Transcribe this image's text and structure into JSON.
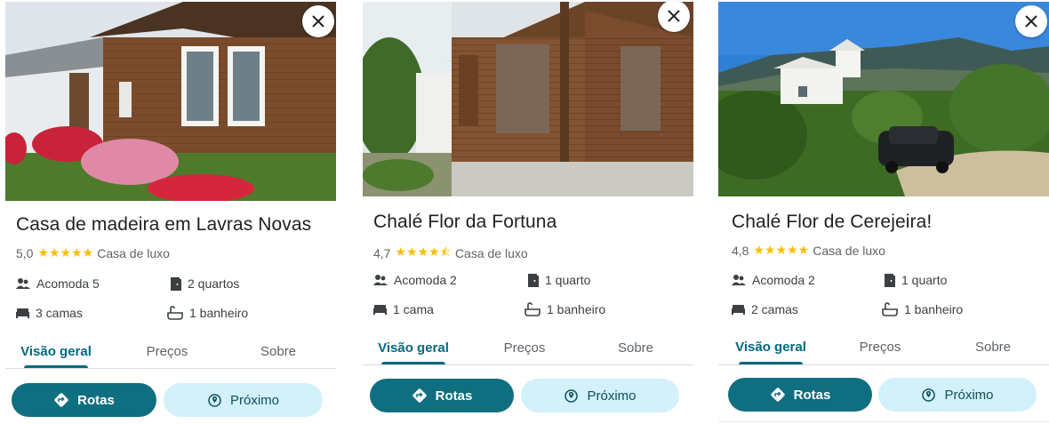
{
  "cards": [
    {
      "title": "Casa de madeira em Lavras Novas",
      "rating": "5,0",
      "stars": "★★★★★",
      "category": "Casa de luxo",
      "guests": "Acomoda 5",
      "bedrooms": "2 quartos",
      "beds": "3 camas",
      "bathrooms": "1 banheiro",
      "tabs": [
        "Visão geral",
        "Preços",
        "Sobre"
      ],
      "directions_label": "Rotas",
      "nearby_label": "Próximo",
      "close_icon": "close-icon"
    },
    {
      "title": "Chalé Flor da Fortuna",
      "rating": "4,7",
      "stars": "★★★★⯪",
      "category": "Casa de luxo",
      "guests": "Acomoda 2",
      "bedrooms": "1 quarto",
      "beds": "1 cama",
      "bathrooms": "1 banheiro",
      "tabs": [
        "Visão geral",
        "Preços",
        "Sobre"
      ],
      "directions_label": "Rotas",
      "nearby_label": "Próximo",
      "close_icon": "close-icon"
    },
    {
      "title": "Chalé Flor de Cerejeira!",
      "rating": "4,8",
      "stars": "★★★★★",
      "category": "Casa de luxo",
      "guests": "Acomoda 2",
      "bedrooms": "1 quarto",
      "beds": "2 camas",
      "bathrooms": "1 banheiro",
      "tabs": [
        "Visão geral",
        "Preços",
        "Sobre"
      ],
      "directions_label": "Rotas",
      "nearby_label": "Próximo",
      "close_icon": "close-icon"
    }
  ],
  "colors": {
    "accent": "#006a80",
    "primary_button": "#0f6f80",
    "secondary_button": "#d2f1fb",
    "star": "#fbbc04"
  }
}
